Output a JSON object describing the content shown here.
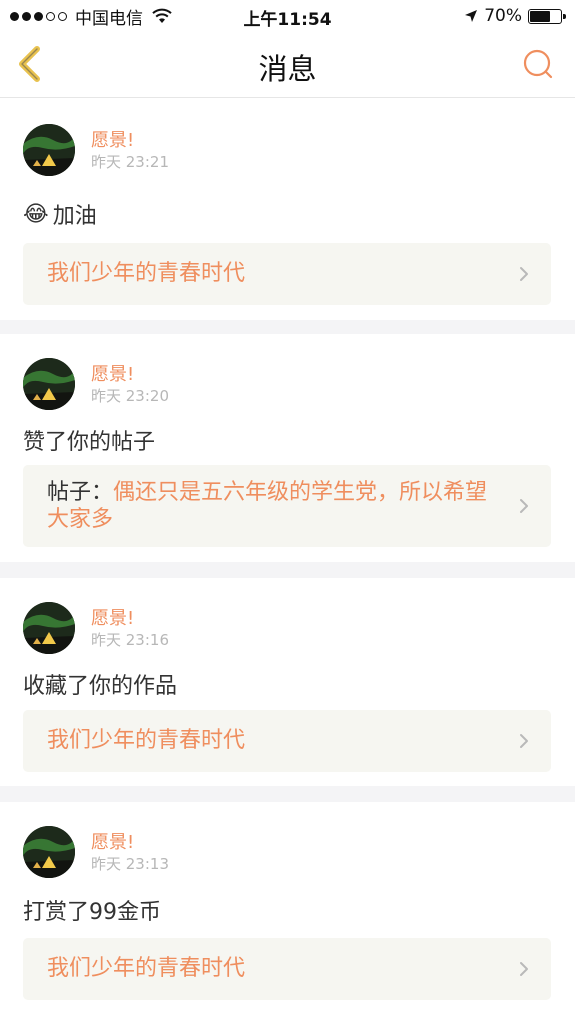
{
  "status_bar": {
    "carrier": "中国电信",
    "time": "上午11:54",
    "battery_percent": "70%",
    "battery_level": 0.7,
    "signal_bars_filled": 3,
    "signal_bars_total": 5
  },
  "nav": {
    "title": "消息",
    "back_icon": "chevron-left-icon",
    "search_icon": "search-icon"
  },
  "colors": {
    "accent": "#ef8e5e",
    "back_arrow": "#e8c24f",
    "muted_text": "#b7b7b7",
    "ref_bg": "#f6f6f1"
  },
  "messages": [
    {
      "sender": "愿景!",
      "time": "昨天 23:21",
      "body_emoji": "😂",
      "body": "加油",
      "ref_prefix": "",
      "ref_title": "我们少年的青春时代"
    },
    {
      "sender": "愿景!",
      "time": "昨天 23:20",
      "body": "赞了你的帖子",
      "ref_prefix": "帖子：",
      "ref_title": "偶还只是五六年级的学生党，所以希望大家多"
    },
    {
      "sender": "愿景!",
      "time": "昨天 23:16",
      "body": "收藏了你的作品",
      "ref_prefix": "",
      "ref_title": "我们少年的青春时代"
    },
    {
      "sender": "愿景!",
      "time": "昨天 23:13",
      "body": "打赏了99金币",
      "ref_prefix": "",
      "ref_title": "我们少年的青春时代"
    }
  ]
}
